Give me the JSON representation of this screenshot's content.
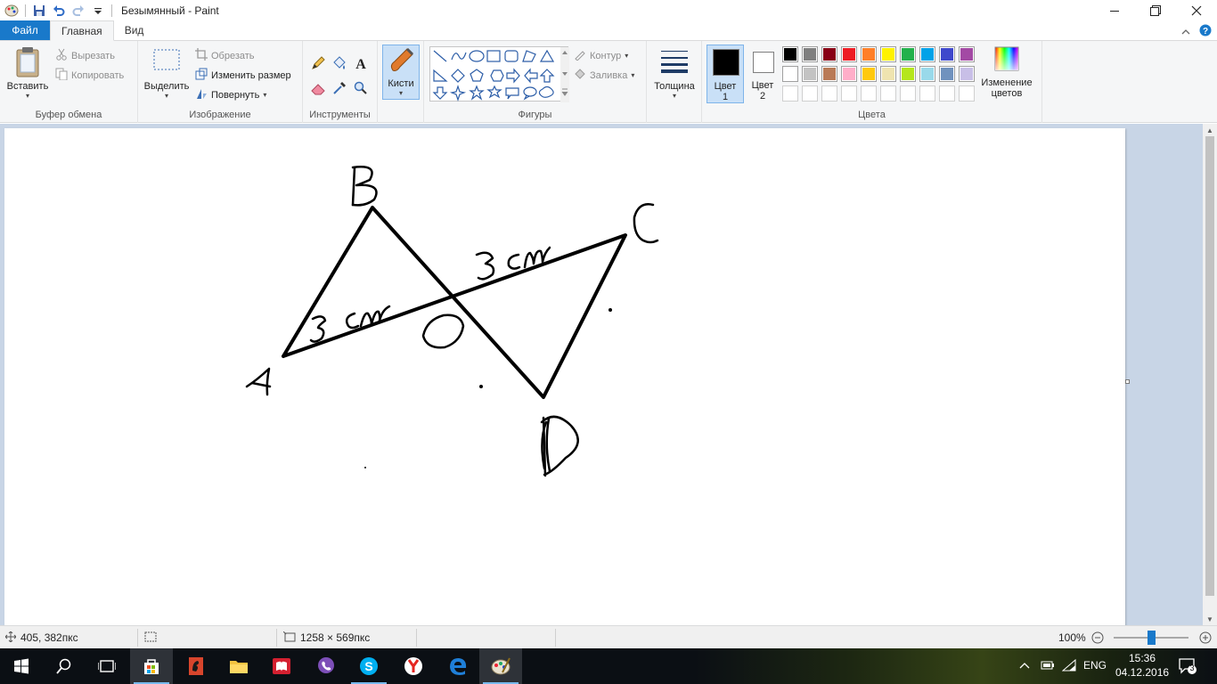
{
  "window": {
    "title": "Безымянный - Paint"
  },
  "tabs": {
    "file": "Файл",
    "home": "Главная",
    "view": "Вид"
  },
  "clipboard": {
    "paste": "Вставить",
    "cut": "Вырезать",
    "copy": "Копировать",
    "label": "Буфер обмена"
  },
  "image": {
    "select": "Выделить",
    "crop": "Обрезать",
    "resize": "Изменить размер",
    "rotate": "Повернуть",
    "label": "Изображение"
  },
  "tools": {
    "label": "Инструменты"
  },
  "brushes": {
    "label": "Кисти"
  },
  "shapes": {
    "outline": "Контур",
    "fill": "Заливка",
    "label": "Фигуры"
  },
  "size": {
    "label": "Толщина"
  },
  "colors": {
    "color1_line1": "Цвет",
    "color1_line2": "1",
    "color2_line1": "Цвет",
    "color2_line2": "2",
    "edit_line1": "Изменение",
    "edit_line2": "цветов",
    "label": "Цвета",
    "color1": "#000000",
    "color2": "#ffffff",
    "palette_row1": [
      "#000000",
      "#7f7f7f",
      "#880015",
      "#ed1c24",
      "#ff7f27",
      "#fff200",
      "#22b14c",
      "#00a2e8",
      "#3f48cc",
      "#a349a4"
    ],
    "palette_row2": [
      "#ffffff",
      "#c3c3c3",
      "#b97a57",
      "#ffaec9",
      "#ffc90e",
      "#efe4b0",
      "#b5e61d",
      "#99d9ea",
      "#7092be",
      "#c8bfe7"
    ]
  },
  "drawing": {
    "labels": [
      "B",
      "C",
      "A",
      "D",
      "3 см",
      "3 см",
      "O"
    ],
    "stroke_color": "#000000"
  },
  "statusbar": {
    "cursor_pos": "405, 382пкс",
    "selection_size": "",
    "image_size": "1258 × 569пкс",
    "zoom": "100%"
  },
  "taskbar": {
    "apps": [
      "start-icon",
      "search-icon",
      "task-view-icon",
      "store-icon",
      "app-red-icon",
      "explorer-icon",
      "reader-icon",
      "viber-icon",
      "skype-icon",
      "yandex-icon",
      "edge-icon",
      "paint-icon"
    ],
    "lang": "ENG",
    "time": "15:36",
    "date": "04.12.2016",
    "notifications": "3"
  }
}
